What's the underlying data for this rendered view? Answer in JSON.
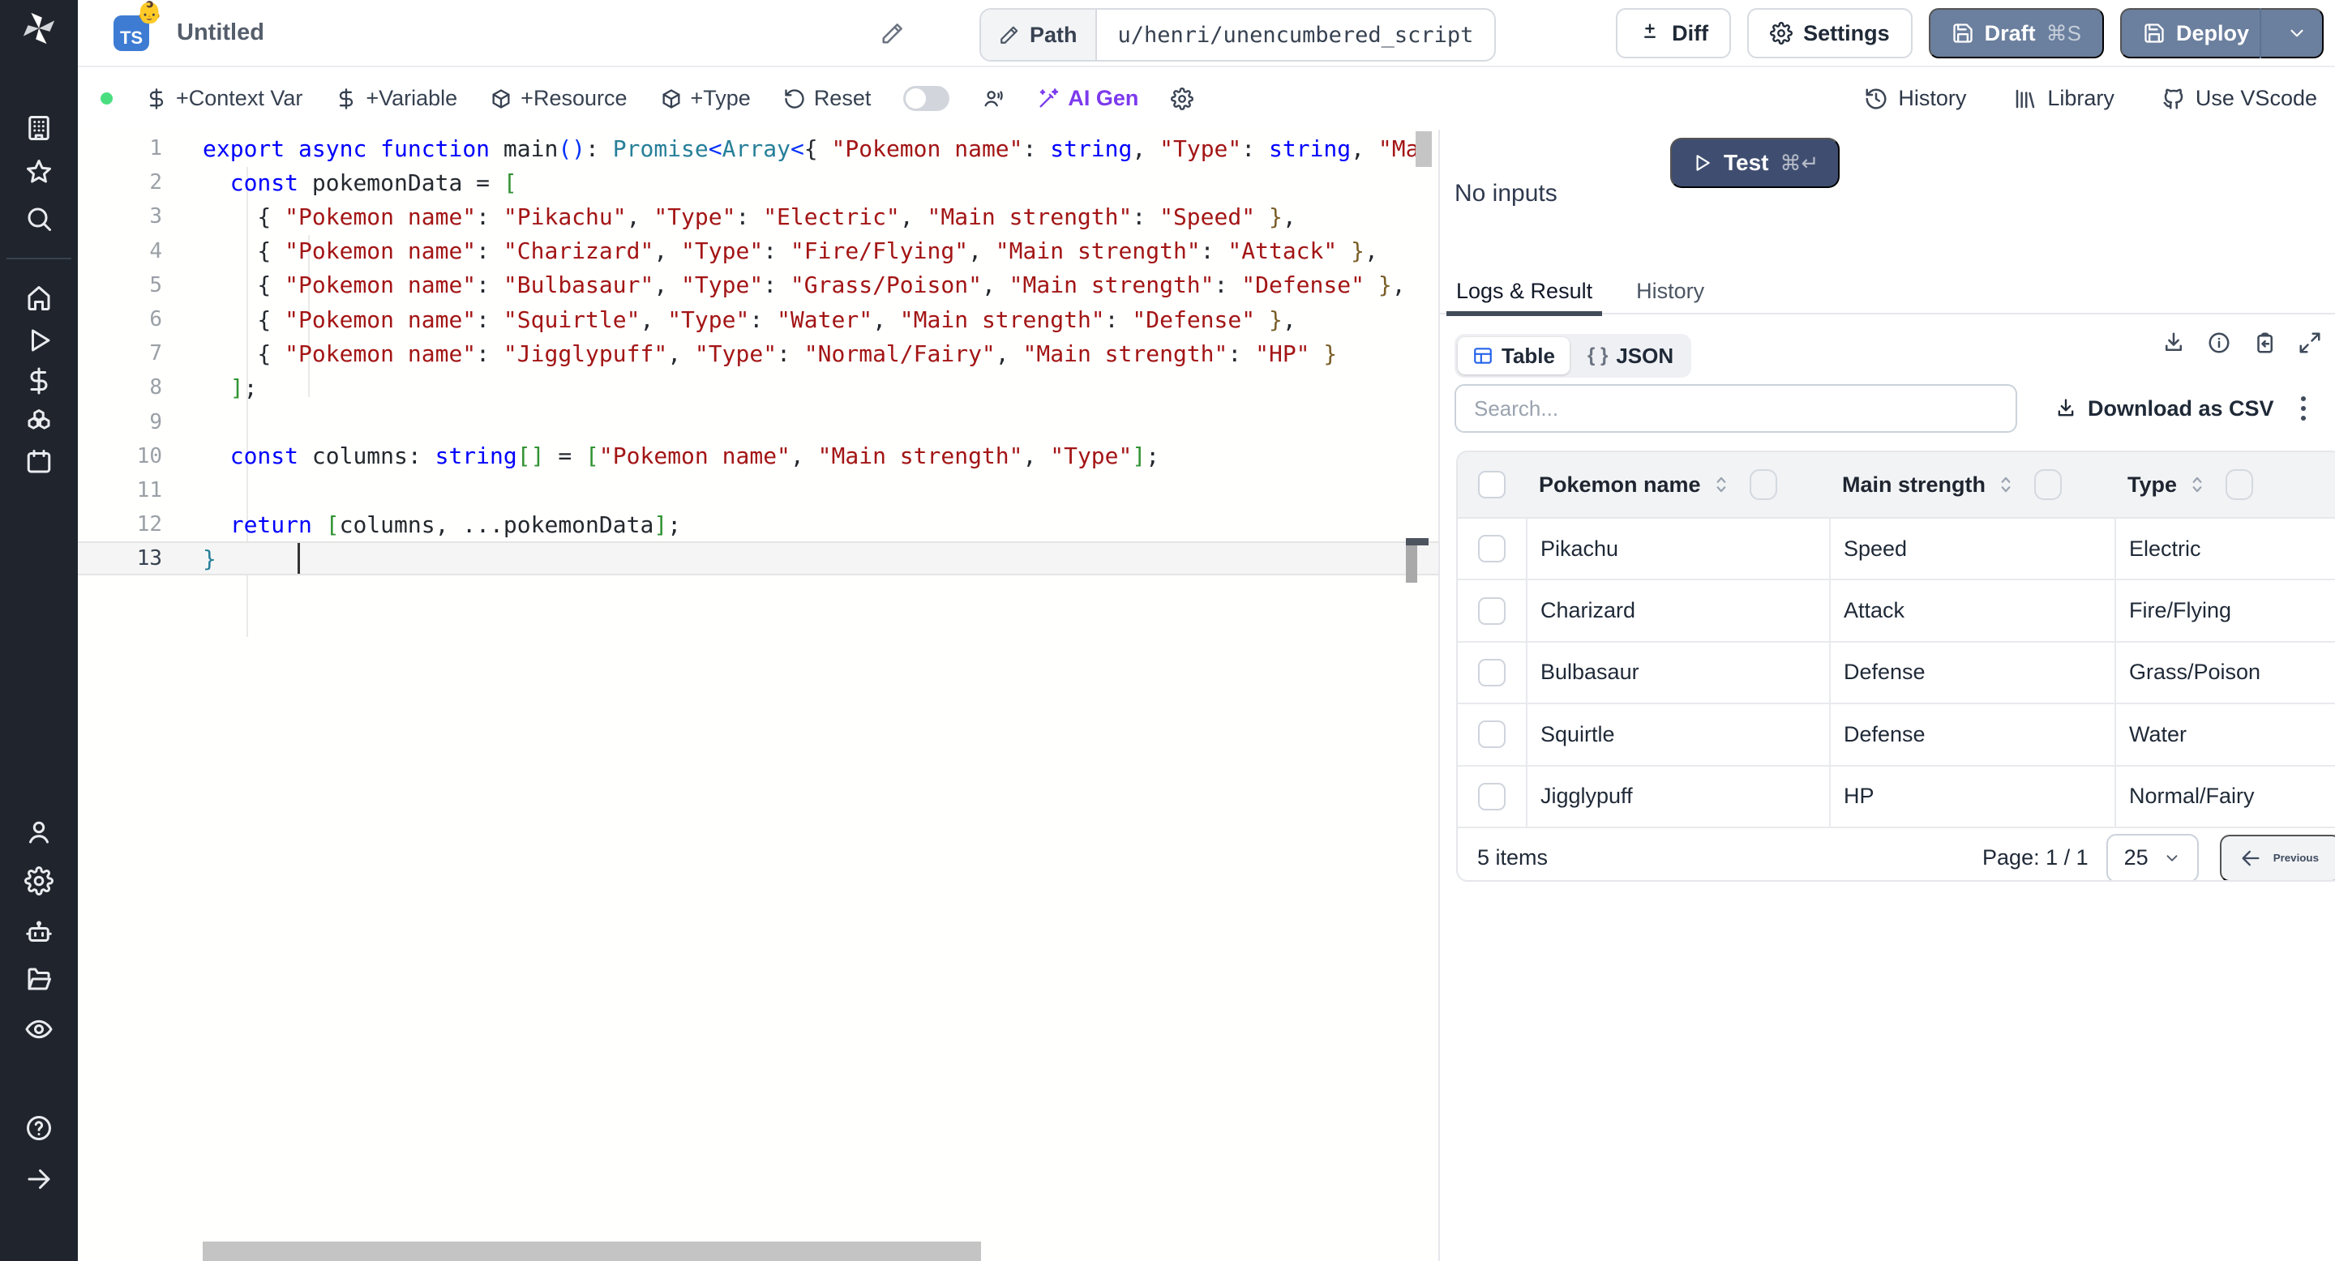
{
  "app": {
    "title": "Untitled",
    "ts_badge": "TS",
    "badge_emoji": "👶",
    "path_label": "Path",
    "path_value": "u/henri/unencumbered_script"
  },
  "header": {
    "diff": "Diff",
    "settings": "Settings",
    "draft": "Draft",
    "draft_kbd": "⌘S",
    "deploy": "Deploy"
  },
  "toolbar": {
    "context_var": "+Context Var",
    "variable": "+Variable",
    "resource": "+Resource",
    "type": "+Type",
    "reset": "Reset",
    "ai_gen": "AI Gen",
    "history": "History",
    "library": "Library",
    "vscode": "Use VScode"
  },
  "run": {
    "test": "Test",
    "test_kbd": "⌘↵",
    "no_inputs": "No inputs"
  },
  "result_panel": {
    "tab_logs": "Logs & Result",
    "tab_history": "History",
    "view_table": "Table",
    "view_json": "JSON",
    "json_braces": "{ }",
    "search_placeholder": "Search...",
    "download_csv": "Download as CSV"
  },
  "result_table": {
    "columns": [
      "Pokemon name",
      "Main strength",
      "Type"
    ],
    "rows": [
      [
        "Pikachu",
        "Speed",
        "Electric"
      ],
      [
        "Charizard",
        "Attack",
        "Fire/Flying"
      ],
      [
        "Bulbasaur",
        "Defense",
        "Grass/Poison"
      ],
      [
        "Squirtle",
        "Defense",
        "Water"
      ],
      [
        "Jigglypuff",
        "HP",
        "Normal/Fairy"
      ]
    ],
    "items_label": "5 items",
    "page_label": "Page: 1 / 1",
    "page_size": "25",
    "previous": "Previous"
  },
  "editor": {
    "active_line": 13,
    "lines": [
      {
        "n": 1,
        "seg": [
          [
            "kw",
            "export"
          ],
          [
            "pl",
            " "
          ],
          [
            "kw",
            "async"
          ],
          [
            "pl",
            " "
          ],
          [
            "kw",
            "function"
          ],
          [
            "pl",
            " "
          ],
          [
            "fn",
            "main"
          ],
          [
            "bb",
            "()"
          ],
          [
            "pl",
            ": "
          ],
          [
            "ty",
            "Promise"
          ],
          [
            "bb",
            "<"
          ],
          [
            "ty",
            "Array"
          ],
          [
            "bb",
            "<"
          ],
          [
            "pl",
            "{ "
          ],
          [
            "st",
            "\"Pokemon name\""
          ],
          [
            "pl",
            ": "
          ],
          [
            "kw",
            "string"
          ],
          [
            "pl",
            ", "
          ],
          [
            "st",
            "\"Type\""
          ],
          [
            "pl",
            ": "
          ],
          [
            "kw",
            "string"
          ],
          [
            "pl",
            ", "
          ],
          [
            "st",
            "\"Mai"
          ]
        ]
      },
      {
        "n": 2,
        "seg": [
          [
            "pl",
            "  "
          ],
          [
            "kw",
            "const"
          ],
          [
            "pl",
            " pokemonData = "
          ],
          [
            "bg",
            "["
          ]
        ]
      },
      {
        "n": 3,
        "seg": [
          [
            "pl",
            "    { "
          ],
          [
            "st",
            "\"Pokemon name\""
          ],
          [
            "pl",
            ": "
          ],
          [
            "st",
            "\"Pikachu\""
          ],
          [
            "pl",
            ", "
          ],
          [
            "st",
            "\"Type\""
          ],
          [
            "pl",
            ": "
          ],
          [
            "st",
            "\"Electric\""
          ],
          [
            "pl",
            ", "
          ],
          [
            "st",
            "\"Main strength\""
          ],
          [
            "pl",
            ": "
          ],
          [
            "st",
            "\"Speed\""
          ],
          [
            "pl",
            " "
          ],
          [
            "bo",
            "}"
          ],
          [
            "pl",
            ","
          ]
        ]
      },
      {
        "n": 4,
        "seg": [
          [
            "pl",
            "    { "
          ],
          [
            "st",
            "\"Pokemon name\""
          ],
          [
            "pl",
            ": "
          ],
          [
            "st",
            "\"Charizard\""
          ],
          [
            "pl",
            ", "
          ],
          [
            "st",
            "\"Type\""
          ],
          [
            "pl",
            ": "
          ],
          [
            "st",
            "\"Fire/Flying\""
          ],
          [
            "pl",
            ", "
          ],
          [
            "st",
            "\"Main strength\""
          ],
          [
            "pl",
            ": "
          ],
          [
            "st",
            "\"Attack\""
          ],
          [
            "pl",
            " "
          ],
          [
            "bo",
            "}"
          ],
          [
            "pl",
            ","
          ]
        ]
      },
      {
        "n": 5,
        "seg": [
          [
            "pl",
            "    { "
          ],
          [
            "st",
            "\"Pokemon name\""
          ],
          [
            "pl",
            ": "
          ],
          [
            "st",
            "\"Bulbasaur\""
          ],
          [
            "pl",
            ", "
          ],
          [
            "st",
            "\"Type\""
          ],
          [
            "pl",
            ": "
          ],
          [
            "st",
            "\"Grass/Poison\""
          ],
          [
            "pl",
            ", "
          ],
          [
            "st",
            "\"Main strength\""
          ],
          [
            "pl",
            ": "
          ],
          [
            "st",
            "\"Defense\""
          ],
          [
            "pl",
            " "
          ],
          [
            "bo",
            "}"
          ],
          [
            "pl",
            ","
          ]
        ]
      },
      {
        "n": 6,
        "seg": [
          [
            "pl",
            "    { "
          ],
          [
            "st",
            "\"Pokemon name\""
          ],
          [
            "pl",
            ": "
          ],
          [
            "st",
            "\"Squirtle\""
          ],
          [
            "pl",
            ", "
          ],
          [
            "st",
            "\"Type\""
          ],
          [
            "pl",
            ": "
          ],
          [
            "st",
            "\"Water\""
          ],
          [
            "pl",
            ", "
          ],
          [
            "st",
            "\"Main strength\""
          ],
          [
            "pl",
            ": "
          ],
          [
            "st",
            "\"Defense\""
          ],
          [
            "pl",
            " "
          ],
          [
            "bo",
            "}"
          ],
          [
            "pl",
            ","
          ]
        ]
      },
      {
        "n": 7,
        "seg": [
          [
            "pl",
            "    { "
          ],
          [
            "st",
            "\"Pokemon name\""
          ],
          [
            "pl",
            ": "
          ],
          [
            "st",
            "\"Jigglypuff\""
          ],
          [
            "pl",
            ", "
          ],
          [
            "st",
            "\"Type\""
          ],
          [
            "pl",
            ": "
          ],
          [
            "st",
            "\"Normal/Fairy\""
          ],
          [
            "pl",
            ", "
          ],
          [
            "st",
            "\"Main strength\""
          ],
          [
            "pl",
            ": "
          ],
          [
            "st",
            "\"HP\""
          ],
          [
            "pl",
            " "
          ],
          [
            "bo",
            "}"
          ]
        ]
      },
      {
        "n": 8,
        "seg": [
          [
            "pl",
            "  "
          ],
          [
            "bg",
            "]"
          ],
          [
            "pl",
            ";"
          ]
        ]
      },
      {
        "n": 9,
        "seg": []
      },
      {
        "n": 10,
        "seg": [
          [
            "pl",
            "  "
          ],
          [
            "kw",
            "const"
          ],
          [
            "pl",
            " columns: "
          ],
          [
            "kw",
            "string"
          ],
          [
            "bg",
            "[]"
          ],
          [
            "pl",
            " = "
          ],
          [
            "bg",
            "["
          ],
          [
            "st",
            "\"Pokemon name\""
          ],
          [
            "pl",
            ", "
          ],
          [
            "st",
            "\"Main strength\""
          ],
          [
            "pl",
            ", "
          ],
          [
            "st",
            "\"Type\""
          ],
          [
            "bg",
            "]"
          ],
          [
            "pl",
            ";"
          ]
        ]
      },
      {
        "n": 11,
        "seg": []
      },
      {
        "n": 12,
        "seg": [
          [
            "pl",
            "  "
          ],
          [
            "kw",
            "return"
          ],
          [
            "pl",
            " "
          ],
          [
            "bg",
            "["
          ],
          [
            "pl",
            "columns, ...pokemonData"
          ],
          [
            "bg",
            "]"
          ],
          [
            "pl",
            ";"
          ]
        ]
      },
      {
        "n": 13,
        "seg": [
          [
            "bt",
            "}"
          ]
        ]
      }
    ]
  }
}
